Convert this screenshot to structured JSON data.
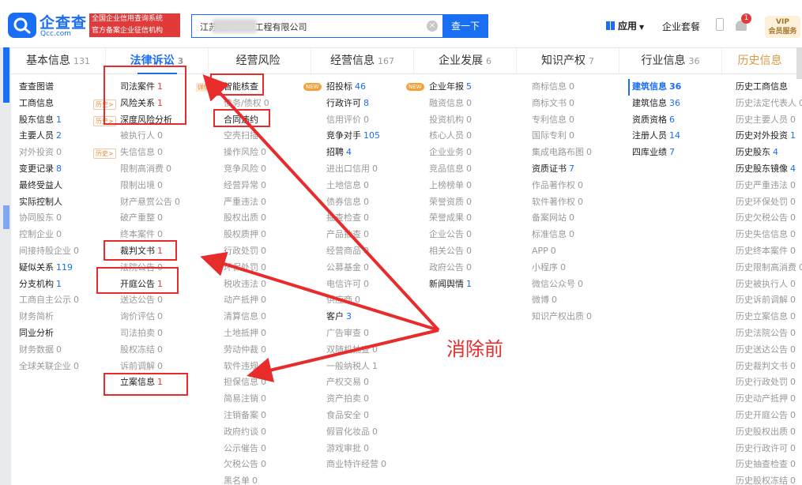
{
  "header": {
    "logo_cn": "企查查",
    "logo_en": "Qcc.com",
    "slogan": [
      "全国企业信用查询系统",
      "官方备案企业征信机构"
    ],
    "search_value": "江苏      建筑装饰工程有限公司",
    "search_button": "查一下",
    "apps_label": "应用",
    "suite_label": "企业套餐",
    "notification_count": "1",
    "vip_line1": "VIP",
    "vip_line2": "会员服务"
  },
  "tabs": [
    {
      "label": "基本信息",
      "count": "131"
    },
    {
      "label": "法律诉讼",
      "count": "3"
    },
    {
      "label": "经营风险",
      "count": ""
    },
    {
      "label": "经营信息",
      "count": "167"
    },
    {
      "label": "企业发展",
      "count": "6"
    },
    {
      "label": "知识产权",
      "count": "7"
    },
    {
      "label": "行业信息",
      "count": "36"
    },
    {
      "label": "历史信息",
      "count": ""
    }
  ],
  "columns": {
    "basic": [
      {
        "label": "查查图谱",
        "count": "",
        "state": "on"
      },
      {
        "label": "工商信息",
        "count": "",
        "state": "on",
        "tag": "历史>"
      },
      {
        "label": "股东信息",
        "count": "1",
        "state": "on",
        "tag": "历史>"
      },
      {
        "label": "主要人员",
        "count": "2",
        "state": "on"
      },
      {
        "label": "对外投资",
        "count": "0",
        "state": "off",
        "tag": "历史>"
      },
      {
        "label": "变更记录",
        "count": "8",
        "state": "on"
      },
      {
        "label": "最终受益人",
        "count": "",
        "state": "on"
      },
      {
        "label": "实际控制人",
        "count": "",
        "state": "on"
      },
      {
        "label": "协同股东",
        "count": "0",
        "state": "off"
      },
      {
        "label": "控制企业",
        "count": "0",
        "state": "off"
      },
      {
        "label": "间接持股企业",
        "count": "0",
        "state": "off"
      },
      {
        "label": "疑似关系",
        "count": "119",
        "state": "on"
      },
      {
        "label": "分支机构",
        "count": "1",
        "state": "on"
      },
      {
        "label": "工商自主公示",
        "count": "0",
        "state": "off"
      },
      {
        "label": "财务简析",
        "count": "",
        "state": "off"
      },
      {
        "label": "同业分析",
        "count": "",
        "state": "on"
      },
      {
        "label": "财务数据",
        "count": "0",
        "state": "off"
      },
      {
        "label": "全球关联企业",
        "count": "0",
        "state": "off"
      }
    ],
    "legal": [
      {
        "label": "司法案件",
        "count": "1",
        "state": "on",
        "tag": "详情>"
      },
      {
        "label": "风险关系",
        "count": "1",
        "state": "on"
      },
      {
        "label": "深度风险分析",
        "count": "",
        "state": "on"
      },
      {
        "label": "被执行人",
        "count": "0",
        "state": "off"
      },
      {
        "label": "失信信息",
        "count": "0",
        "state": "off"
      },
      {
        "label": "限制高消费",
        "count": "0",
        "state": "off"
      },
      {
        "label": "限制出境",
        "count": "0",
        "state": "off"
      },
      {
        "label": "财产悬赏公告",
        "count": "0",
        "state": "off"
      },
      {
        "label": "破产重整",
        "count": "0",
        "state": "off"
      },
      {
        "label": "终本案件",
        "count": "0",
        "state": "off"
      },
      {
        "label": "裁判文书",
        "count": "1",
        "state": "on"
      },
      {
        "label": "法院公告",
        "count": "0",
        "state": "off"
      },
      {
        "label": "开庭公告",
        "count": "1",
        "state": "on"
      },
      {
        "label": "送达公告",
        "count": "0",
        "state": "off"
      },
      {
        "label": "询价评估",
        "count": "0",
        "state": "off"
      },
      {
        "label": "司法拍卖",
        "count": "0",
        "state": "off"
      },
      {
        "label": "股权冻结",
        "count": "0",
        "state": "off"
      },
      {
        "label": "诉前调解",
        "count": "0",
        "state": "off"
      },
      {
        "label": "立案信息",
        "count": "1",
        "state": "on"
      }
    ],
    "risk": [
      {
        "label": "智能核查",
        "count": "",
        "state": "on",
        "tag": "NEW"
      },
      {
        "label": "债务/债权",
        "count": "0",
        "state": "off"
      },
      {
        "label": "合同违约",
        "count": "",
        "state": "on"
      },
      {
        "label": "空壳扫描",
        "count": "",
        "state": "off"
      },
      {
        "label": "操作风险",
        "count": "0",
        "state": "off"
      },
      {
        "label": "竞争风险",
        "count": "0",
        "state": "off"
      },
      {
        "label": "经营异常",
        "count": "0",
        "state": "off"
      },
      {
        "label": "严重违法",
        "count": "0",
        "state": "off"
      },
      {
        "label": "股权出质",
        "count": "0",
        "state": "off"
      },
      {
        "label": "股权质押",
        "count": "0",
        "state": "off"
      },
      {
        "label": "行政处罚",
        "count": "0",
        "state": "off"
      },
      {
        "label": "环保处罚",
        "count": "0",
        "state": "off"
      },
      {
        "label": "税收违法",
        "count": "0",
        "state": "off"
      },
      {
        "label": "动产抵押",
        "count": "0",
        "state": "off"
      },
      {
        "label": "清算信息",
        "count": "0",
        "state": "off"
      },
      {
        "label": "土地抵押",
        "count": "0",
        "state": "off"
      },
      {
        "label": "劳动仲裁",
        "count": "0",
        "state": "off"
      },
      {
        "label": "软件违规",
        "count": "0",
        "state": "off"
      },
      {
        "label": "担保信息",
        "count": "0",
        "state": "off"
      },
      {
        "label": "简易注销",
        "count": "0",
        "state": "off"
      },
      {
        "label": "注销备案",
        "count": "0",
        "state": "off"
      },
      {
        "label": "政府约谈",
        "count": "0",
        "state": "off"
      },
      {
        "label": "公示催告",
        "count": "0",
        "state": "off"
      },
      {
        "label": "欠税公告",
        "count": "0",
        "state": "off"
      },
      {
        "label": "黑名单",
        "count": "0",
        "state": "off"
      }
    ],
    "business": [
      {
        "label": "招投标",
        "count": "46",
        "state": "on",
        "tag": "NEW"
      },
      {
        "label": "行政许可",
        "count": "8",
        "state": "on"
      },
      {
        "label": "信用评价",
        "count": "0",
        "state": "off"
      },
      {
        "label": "竞争对手",
        "count": "105",
        "state": "on"
      },
      {
        "label": "招聘",
        "count": "4",
        "state": "on"
      },
      {
        "label": "进出口信用",
        "count": "0",
        "state": "off"
      },
      {
        "label": "土地信息",
        "count": "0",
        "state": "off"
      },
      {
        "label": "债券信息",
        "count": "0",
        "state": "off"
      },
      {
        "label": "抽查检查",
        "count": "0",
        "state": "off"
      },
      {
        "label": "产品抽查",
        "count": "0",
        "state": "off"
      },
      {
        "label": "经营商品",
        "count": "0",
        "state": "off"
      },
      {
        "label": "公募基金",
        "count": "0",
        "state": "off"
      },
      {
        "label": "电信许可",
        "count": "0",
        "state": "off"
      },
      {
        "label": "供应商",
        "count": "0",
        "state": "off"
      },
      {
        "label": "客户",
        "count": "3",
        "state": "on"
      },
      {
        "label": "广告审查",
        "count": "0",
        "state": "off"
      },
      {
        "label": "双随机抽查",
        "count": "0",
        "state": "off"
      },
      {
        "label": "一般纳税人",
        "count": "1",
        "state": "off"
      },
      {
        "label": "产权交易",
        "count": "0",
        "state": "off"
      },
      {
        "label": "资产拍卖",
        "count": "0",
        "state": "off"
      },
      {
        "label": "食品安全",
        "count": "0",
        "state": "off"
      },
      {
        "label": "假冒化妆品",
        "count": "0",
        "state": "off"
      },
      {
        "label": "游戏审批",
        "count": "0",
        "state": "off"
      },
      {
        "label": "商业特许经营",
        "count": "0",
        "state": "off"
      }
    ],
    "develop": [
      {
        "label": "企业年报",
        "count": "5",
        "state": "on"
      },
      {
        "label": "融资信息",
        "count": "0",
        "state": "off"
      },
      {
        "label": "投资机构",
        "count": "0",
        "state": "off"
      },
      {
        "label": "核心人员",
        "count": "0",
        "state": "off"
      },
      {
        "label": "企业业务",
        "count": "0",
        "state": "off"
      },
      {
        "label": "竞品信息",
        "count": "0",
        "state": "off"
      },
      {
        "label": "上榜榜单",
        "count": "0",
        "state": "off"
      },
      {
        "label": "荣誉资质",
        "count": "0",
        "state": "off"
      },
      {
        "label": "荣誉成果",
        "count": "0",
        "state": "off"
      },
      {
        "label": "企业公告",
        "count": "0",
        "state": "off"
      },
      {
        "label": "相关公告",
        "count": "0",
        "state": "off"
      },
      {
        "label": "政府公告",
        "count": "0",
        "state": "off"
      },
      {
        "label": "新闻舆情",
        "count": "1",
        "state": "on"
      }
    ],
    "ip": [
      {
        "label": "商标信息",
        "count": "0",
        "state": "off"
      },
      {
        "label": "商标文书",
        "count": "0",
        "state": "off"
      },
      {
        "label": "专利信息",
        "count": "0",
        "state": "off"
      },
      {
        "label": "国际专利",
        "count": "0",
        "state": "off"
      },
      {
        "label": "集成电路布图",
        "count": "0",
        "state": "off"
      },
      {
        "label": "资质证书",
        "count": "7",
        "state": "on"
      },
      {
        "label": "作品著作权",
        "count": "0",
        "state": "off"
      },
      {
        "label": "软件著作权",
        "count": "0",
        "state": "off"
      },
      {
        "label": "备案网站",
        "count": "0",
        "state": "off"
      },
      {
        "label": "标准信息",
        "count": "0",
        "state": "off"
      },
      {
        "label": "APP",
        "count": "0",
        "state": "off"
      },
      {
        "label": "小程序",
        "count": "0",
        "state": "off"
      },
      {
        "label": "微信公众号",
        "count": "0",
        "state": "off"
      },
      {
        "label": "微博",
        "count": "0",
        "state": "off"
      },
      {
        "label": "知识产权出质",
        "count": "0",
        "state": "off"
      }
    ],
    "industry": [
      {
        "label": "建筑信息",
        "count": "36",
        "state": "head"
      },
      {
        "label": "建筑信息",
        "count": "36",
        "state": "on"
      },
      {
        "label": "资质资格",
        "count": "6",
        "state": "on"
      },
      {
        "label": "注册人员",
        "count": "14",
        "state": "on"
      },
      {
        "label": "四库业绩",
        "count": "7",
        "state": "on"
      }
    ],
    "history": [
      {
        "label": "历史工商信息",
        "count": "",
        "state": "on"
      },
      {
        "label": "历史法定代表人",
        "count": "0",
        "state": "off"
      },
      {
        "label": "历史主要人员",
        "count": "0",
        "state": "off"
      },
      {
        "label": "历史对外投资",
        "count": "1",
        "state": "on"
      },
      {
        "label": "历史股东",
        "count": "4",
        "state": "on"
      },
      {
        "label": "历史股东镜像",
        "count": "4",
        "state": "on"
      },
      {
        "label": "历史严重违法",
        "count": "0",
        "state": "off"
      },
      {
        "label": "历史环保处罚",
        "count": "0",
        "state": "off"
      },
      {
        "label": "历史欠税公告",
        "count": "0",
        "state": "off"
      },
      {
        "label": "历史失信信息",
        "count": "0",
        "state": "off"
      },
      {
        "label": "历史终本案件",
        "count": "0",
        "state": "off"
      },
      {
        "label": "历史限制高消费",
        "count": "0",
        "state": "off"
      },
      {
        "label": "历史被执行人",
        "count": "0",
        "state": "off"
      },
      {
        "label": "历史诉前调解",
        "count": "0",
        "state": "off"
      },
      {
        "label": "历史立案信息",
        "count": "0",
        "state": "off"
      },
      {
        "label": "历史法院公告",
        "count": "0",
        "state": "off"
      },
      {
        "label": "历史送达公告",
        "count": "0",
        "state": "off"
      },
      {
        "label": "历史裁判文书",
        "count": "0",
        "state": "off"
      },
      {
        "label": "历史行政处罚",
        "count": "0",
        "state": "off"
      },
      {
        "label": "历史动产抵押",
        "count": "0",
        "state": "off"
      },
      {
        "label": "历史开庭公告",
        "count": "0",
        "state": "off"
      },
      {
        "label": "历史股权出质",
        "count": "0",
        "state": "off"
      },
      {
        "label": "历史行政许可",
        "count": "0",
        "state": "off"
      },
      {
        "label": "历史抽查检查",
        "count": "0",
        "state": "off"
      },
      {
        "label": "历史股权冻结",
        "count": "0",
        "state": "off"
      }
    ]
  },
  "annotation": "消除前",
  "colors": {
    "brand": "#1a6ef2",
    "annotation": "#e82b2b",
    "inactive": "#999999",
    "history_tab": "#d89a46"
  }
}
